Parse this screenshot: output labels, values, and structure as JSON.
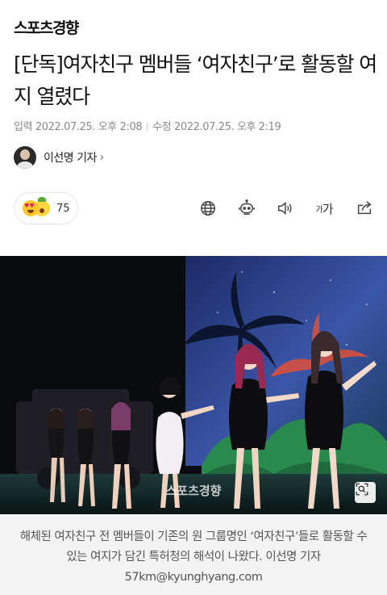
{
  "header": {
    "logo_text": "스포츠경향"
  },
  "article": {
    "title": "[단독]여자친구 멤버들 ‘여자친구’로 활동할 여지 열렸다",
    "published": "입력 2022.07.25. 오후 2:08",
    "modified": "수정 2022.07.25. 오후 2:19",
    "reporter": "이선명 기자",
    "reporter_chevron": "›"
  },
  "reactions": {
    "count": "75",
    "emojis": [
      "heart-eyes-emoji",
      "surprised-emoji"
    ]
  },
  "toolbar": {
    "icons": [
      "globe-icon",
      "robot-icon",
      "speaker-icon",
      "font-size-icon",
      "share-icon"
    ],
    "font_size_small": "가",
    "font_size_large": "가"
  },
  "photo": {
    "watermark": "스포츠경향",
    "zoom_icon": "zoom-icon"
  },
  "caption": "해체된 여자친구 전 멤버들이 기존의 원 그룹명인 ‘여자친구’들로 활동할 수 있는 여지가 담긴 특허청의 해석이 나왔다. 이선명 기자 57km@kyunghyang.com",
  "colors": {
    "text": "#111111",
    "meta": "#888888",
    "caption_bg": "#f4f4f4",
    "caption_text": "#555555"
  }
}
